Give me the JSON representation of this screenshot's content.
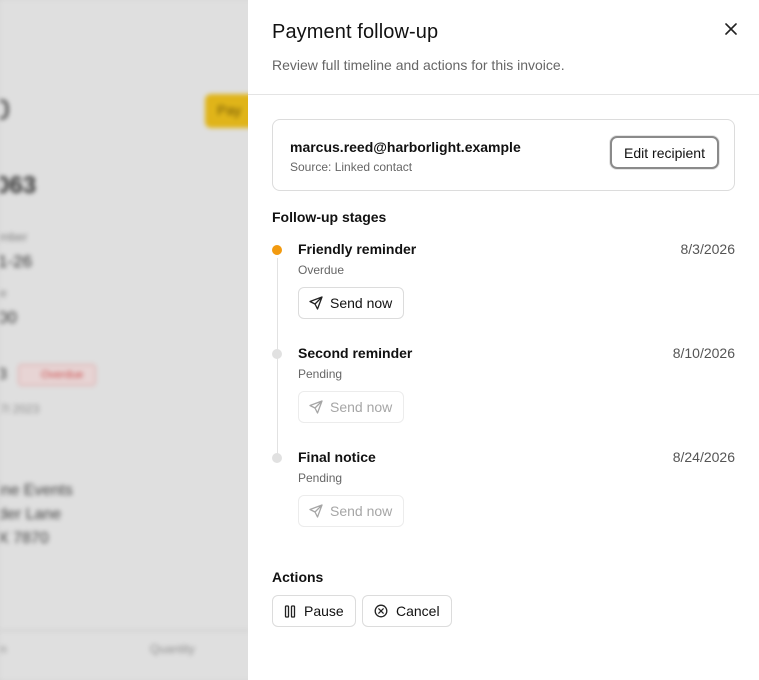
{
  "background": {
    "texts": [
      "0",
      "063",
      "mber",
      "1-26",
      "e",
      "00",
      "3",
      "Overdue",
      "7l 2023",
      "ine Events",
      "der Lane",
      "X 7870",
      "n",
      "Quantity",
      "Pay"
    ]
  },
  "drawer": {
    "title": "Payment follow-up",
    "subtitle": "Review full timeline and actions for this invoice.",
    "close_icon": "close-icon"
  },
  "recipient": {
    "email": "marcus.reed@harborlight.example",
    "source": "Source: Linked contact",
    "edit_label": "Edit recipient"
  },
  "stages_label": "Follow-up stages",
  "stages": [
    {
      "name": "Friendly reminder",
      "status": "Overdue",
      "date": "8/3/2026",
      "button": "Send now",
      "state": "active"
    },
    {
      "name": "Second reminder",
      "status": "Pending",
      "date": "8/10/2026",
      "button": "Send now",
      "state": "pending"
    },
    {
      "name": "Final notice",
      "status": "Pending",
      "date": "8/24/2026",
      "button": "Send now",
      "state": "pending"
    }
  ],
  "actions_label": "Actions",
  "actions": {
    "pause_label": "Pause",
    "cancel_label": "Cancel"
  },
  "colors": {
    "active_dot": "#f29a0f",
    "pending_dot": "#e1e1e1",
    "pay_button": "#f5c518"
  }
}
